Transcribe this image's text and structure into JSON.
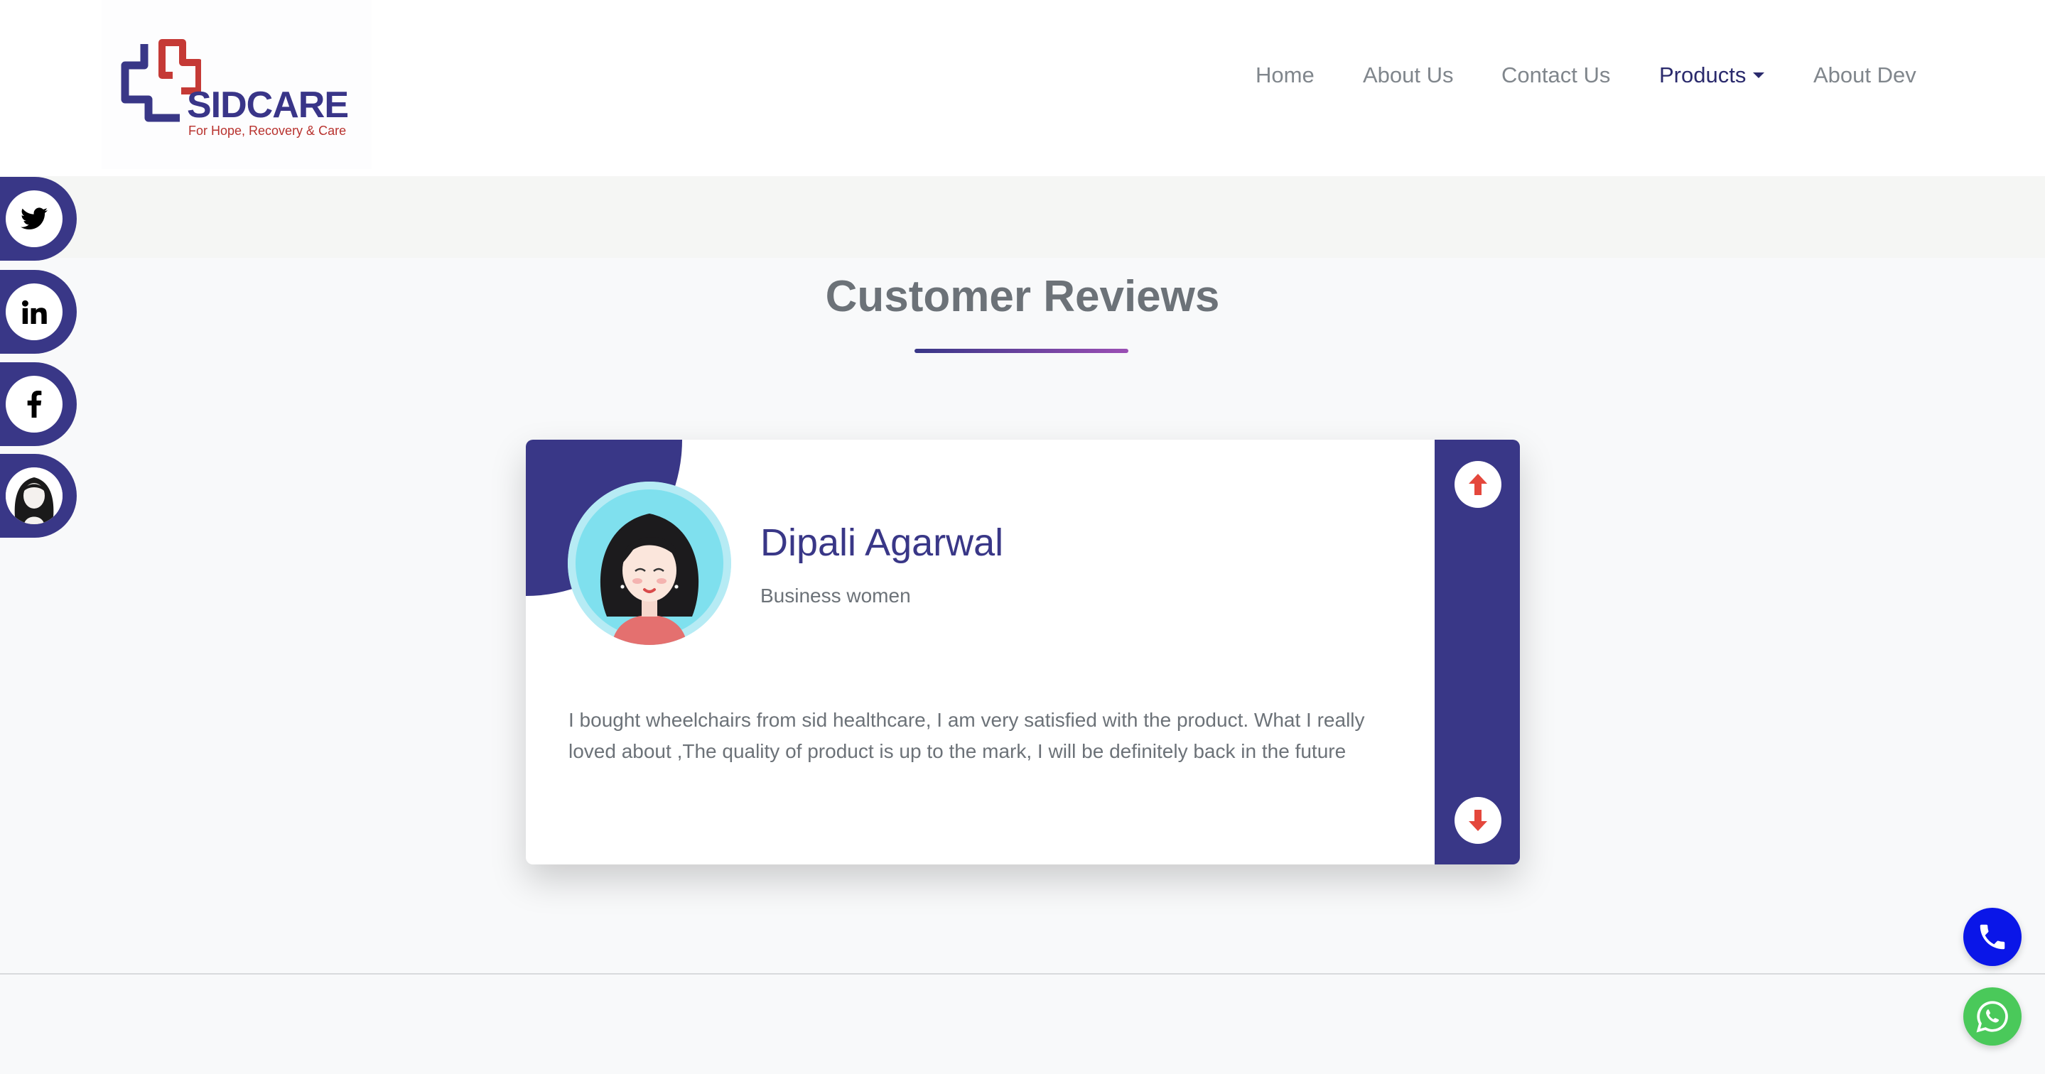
{
  "brand": {
    "name": "SIDCARE",
    "tagline": "For Hope, Recovery & Care",
    "colors": {
      "primary": "#393787",
      "accent": "#c53a36"
    }
  },
  "nav": {
    "items": [
      {
        "label": "Home",
        "active": false
      },
      {
        "label": "About Us",
        "active": false
      },
      {
        "label": "Contact Us",
        "active": false
      },
      {
        "label": "Products",
        "active": true,
        "dropdown": true
      },
      {
        "label": "About Dev",
        "active": false
      }
    ]
  },
  "social": [
    {
      "icon": "twitter-icon"
    },
    {
      "icon": "linkedin-icon"
    },
    {
      "icon": "facebook-icon"
    },
    {
      "icon": "avatar-icon"
    }
  ],
  "reviews": {
    "title": "Customer Reviews",
    "current": {
      "name": "Dipali Agarwal",
      "role": "Business women",
      "text": "I bought wheelchairs from sid healthcare, I am very satisfied with the product. What I really loved about ,The quality of product is up to the mark, I will be definitely back in the future"
    },
    "controls": {
      "up_icon": "arrow-up-icon",
      "down_icon": "arrow-down-icon"
    }
  },
  "floating": {
    "call": {
      "icon": "phone-icon",
      "color": "#0a16e8"
    },
    "whatsapp": {
      "icon": "whatsapp-icon",
      "color": "#4ac95a"
    }
  }
}
